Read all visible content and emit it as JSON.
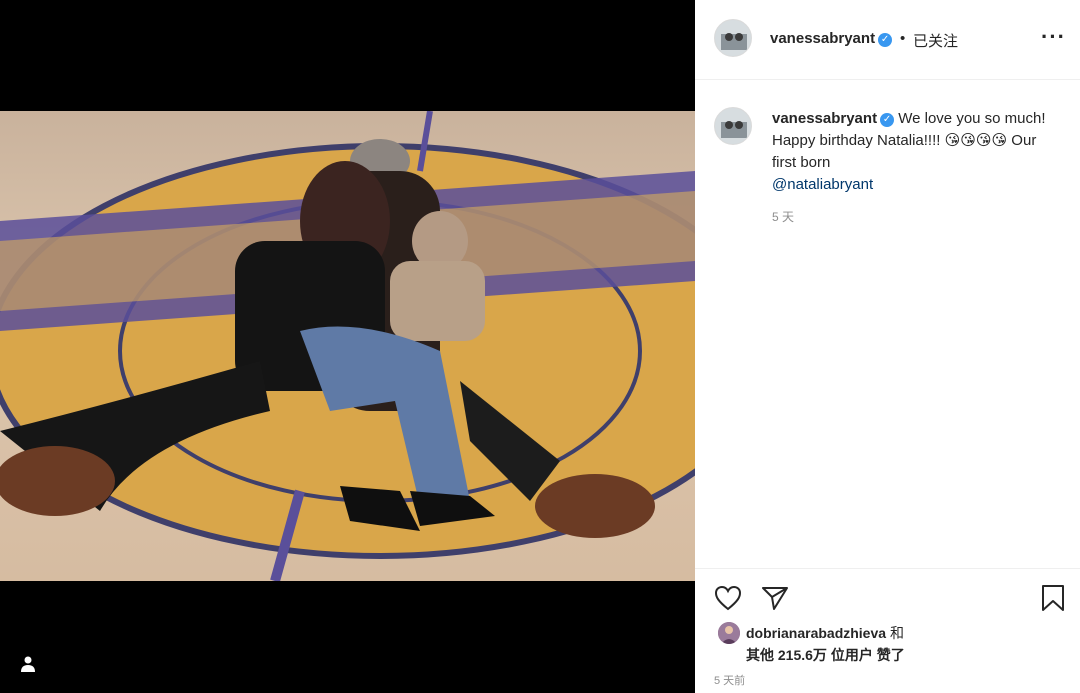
{
  "post": {
    "username": "vanessabryant",
    "follow_status": "已关注",
    "separator": "•",
    "more_icon": "more-horizontal-icon"
  },
  "caption": {
    "username": "vanessabryant",
    "text": "We love you so much! Happy birthday Natalia!!!! 😘😘😘😘 Our first born",
    "mention": "@nataliabryant",
    "time": "5 天"
  },
  "likes": {
    "liker": "dobrianarabadzhieva",
    "and_text": "和",
    "others_text": "其他 215.6万 位用户 赞了"
  },
  "footer": {
    "time": "5 天前"
  },
  "colors": {
    "verified": "#3897f0",
    "link": "#00376b",
    "muted": "#8e8e8e"
  }
}
